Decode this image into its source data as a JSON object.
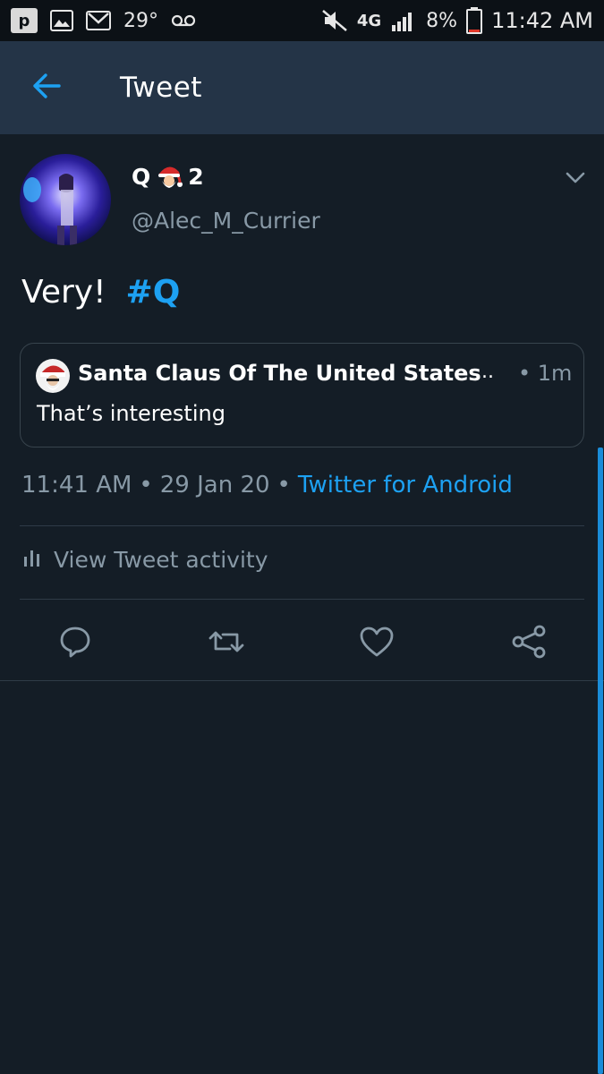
{
  "statusbar": {
    "notif_letter": "p",
    "temperature": "29°",
    "network": "4G",
    "battery_pct": "8%",
    "time": "11:42 AM"
  },
  "header": {
    "title": "Tweet"
  },
  "tweet": {
    "author_name": "Q",
    "author_suffix": "2",
    "author_handle": "@Alec_M_Currier",
    "text": "Very!",
    "hashtag": "#Q",
    "timestamp": "11:41 AM",
    "date": "29 Jan 20",
    "source": "Twitter for Android",
    "separator": "•"
  },
  "quote": {
    "author_name": "Santa Claus Of The United States",
    "ellipsis": "...",
    "time": "• 1m",
    "text": "That’s interesting"
  },
  "activity": {
    "label": "View Tweet activity"
  },
  "actions": [
    "reply-icon",
    "retweet-icon",
    "like-icon",
    "share-icon"
  ],
  "colors": {
    "background": "#141d26",
    "header": "#243447",
    "accent": "#1da1f2",
    "muted": "#8899a6"
  }
}
